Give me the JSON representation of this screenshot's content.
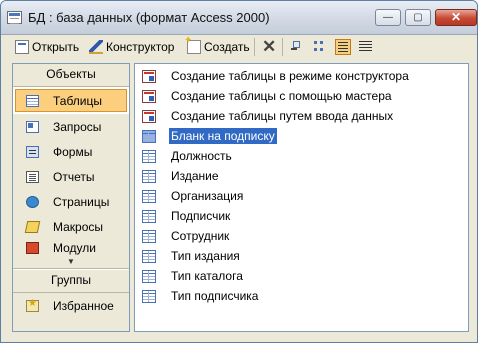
{
  "window": {
    "title": "БД : база данных (формат Access 2000)",
    "controls": {
      "minimize": "—",
      "maximize": "▢",
      "close": "✕"
    }
  },
  "toolbar": {
    "open_label": "Открыть",
    "design_label": "Конструктор",
    "new_label": "Создать",
    "delete_glyph": "✕"
  },
  "sidebar": {
    "objects_header": "Объекты",
    "items": [
      {
        "label": "Таблицы",
        "icon": "table-icon",
        "selected": true
      },
      {
        "label": "Запросы",
        "icon": "query-icon"
      },
      {
        "label": "Формы",
        "icon": "form-icon"
      },
      {
        "label": "Отчеты",
        "icon": "report-icon"
      },
      {
        "label": "Страницы",
        "icon": "page-icon"
      },
      {
        "label": "Макросы",
        "icon": "macro-icon"
      },
      {
        "label": "Модули",
        "icon": "module-icon"
      }
    ],
    "scroll_glyph": "▼",
    "groups_header": "Группы",
    "groups": [
      {
        "label": "Избранное",
        "icon": "favorites-icon"
      }
    ]
  },
  "list": {
    "items": [
      {
        "label": "Создание таблицы в режиме конструктора",
        "icon": "shortcut-icon"
      },
      {
        "label": "Создание таблицы с помощью мастера",
        "icon": "shortcut-icon"
      },
      {
        "label": "Создание таблицы путем ввода данных",
        "icon": "shortcut-icon"
      },
      {
        "label": "Бланк на подписку",
        "icon": "table-icon",
        "selected": true
      },
      {
        "label": "Должность",
        "icon": "table-icon"
      },
      {
        "label": "Издание",
        "icon": "table-icon"
      },
      {
        "label": "Организация",
        "icon": "table-icon"
      },
      {
        "label": "Подписчик",
        "icon": "table-icon"
      },
      {
        "label": "Сотрудник",
        "icon": "table-icon"
      },
      {
        "label": "Тип издания",
        "icon": "table-icon"
      },
      {
        "label": "Тип каталога",
        "icon": "table-icon"
      },
      {
        "label": "Тип подписчика",
        "icon": "table-icon"
      }
    ]
  },
  "colors": {
    "selection": "#316ac5",
    "sidebar_selected": "#fccf7e",
    "window_bg": "#ece9d8"
  }
}
